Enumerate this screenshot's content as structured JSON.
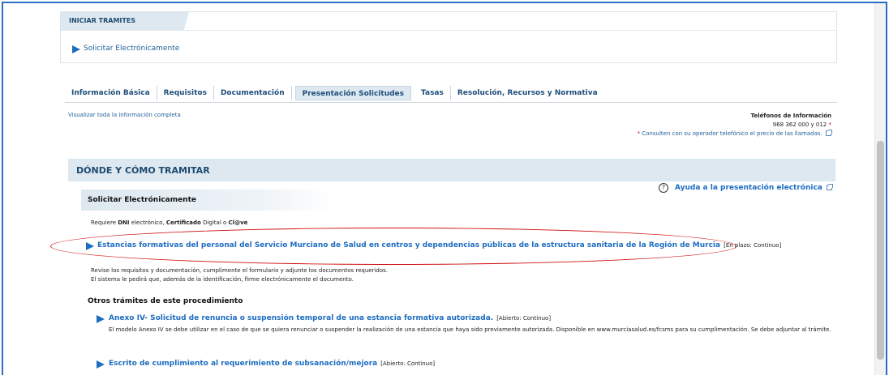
{
  "iniciar": {
    "heading": "INICIAR TRAMITES",
    "link": "Solicitar Electrónicamente"
  },
  "tabs": [
    {
      "label": "Información Básica",
      "active": false
    },
    {
      "label": "Requisitos",
      "active": false
    },
    {
      "label": "Documentación",
      "active": false
    },
    {
      "label": "Presentación Solicitudes",
      "active": true
    },
    {
      "label": "Tasas",
      "active": false
    },
    {
      "label": "Resolución, Recursos y Normativa",
      "active": false
    }
  ],
  "info": {
    "visualizar": "Visualizar toda la información completa",
    "tel_title": "Teléfonos de Información",
    "tel_numbers": "968 362 000 y 012",
    "asterisk": "*",
    "consulten": "Consulten con su operador telefónico el precio de las llamadas."
  },
  "donde": {
    "heading": "DÓNDE Y CÓMO TRAMITAR",
    "solicitar": "Solicitar Electrónicamente",
    "ayuda": "Ayuda a la presentación electrónica",
    "requiere_prefix": "Requiere ",
    "dni": "DNI",
    "electronico": " electrónico, ",
    "certificado": "Certificado",
    "digital_o": " Digital o ",
    "clave": "Cl@ve",
    "main_link": "Estancias formativas del personal del Servicio Murciano de Salud en centros y dependencias públicas de la estructura sanitaria de la Región de Murcia",
    "main_status": "[En plazo: Continuo]",
    "revise_1": "Revise los requisitos y documentación, cumplimente el formulario y adjunte los documentos requeridos.",
    "revise_2": "El sistema le pedirá que, además de la identificación, firme electrónicamente el documento."
  },
  "otros": {
    "heading": "Otros trámites de este procedimiento",
    "items": [
      {
        "title": "Anexo IV- Solicitud de renuncia o suspensión temporal de una estancia formativa autorizada.",
        "status": "[Abierto: Continuo]",
        "desc": "El modelo Anexo IV se debe utilizar en el caso de que se quiera renunciar o suspender la realización de una estancia que haya sido previamente autorizada. Disponible en www.murciasalud.es/fcsms para su cumplimentación. Se debe adjuntar al trámite."
      },
      {
        "title": "Escrito de cumplimiento al requerimiento de subsanación/mejora",
        "status": "[Abierto: Continuo]"
      }
    ]
  },
  "colors": {
    "link": "#1e6dc0",
    "highlight_ellipse": "#d01010",
    "section_bg": "#dde8f0"
  }
}
